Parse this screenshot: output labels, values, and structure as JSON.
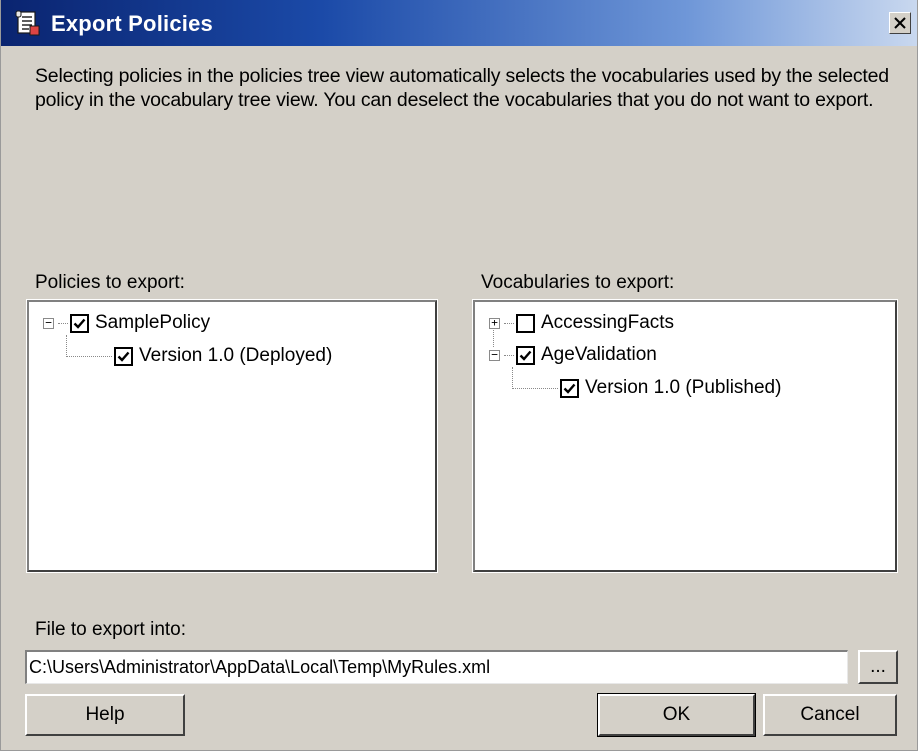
{
  "window": {
    "title": "Export Policies",
    "icon": "policy-scroll-icon",
    "close_glyph": "✕"
  },
  "description": "Selecting policies in the policies tree view automatically selects the vocabularies used by the selected policy in the vocabulary tree view. You can deselect the vocabularies that you do not want to export.",
  "policies": {
    "label": "Policies to export:",
    "tree": [
      {
        "label": "SamplePolicy",
        "checked": true,
        "expanded": true,
        "expander": "−"
      },
      {
        "label": "Version 1.0 (Deployed)",
        "checked": true
      }
    ]
  },
  "vocabularies": {
    "label": "Vocabularies to export:",
    "tree": [
      {
        "label": "AccessingFacts",
        "checked": false,
        "expanded": false,
        "expander": "+"
      },
      {
        "label": "AgeValidation",
        "checked": true,
        "expanded": true,
        "expander": "−"
      },
      {
        "label": "Version 1.0 (Published)",
        "checked": true
      }
    ]
  },
  "file": {
    "label": "File to export into:",
    "value": "C:\\Users\\Administrator\\AppData\\Local\\Temp\\MyRules.xml",
    "browse_label": "..."
  },
  "buttons": {
    "help": "Help",
    "ok": "OK",
    "cancel": "Cancel"
  },
  "colors": {
    "title_gradient_start": "#0a2470",
    "title_gradient_end": "#c9d8ef",
    "dialog_bg": "#d4d0c8"
  }
}
